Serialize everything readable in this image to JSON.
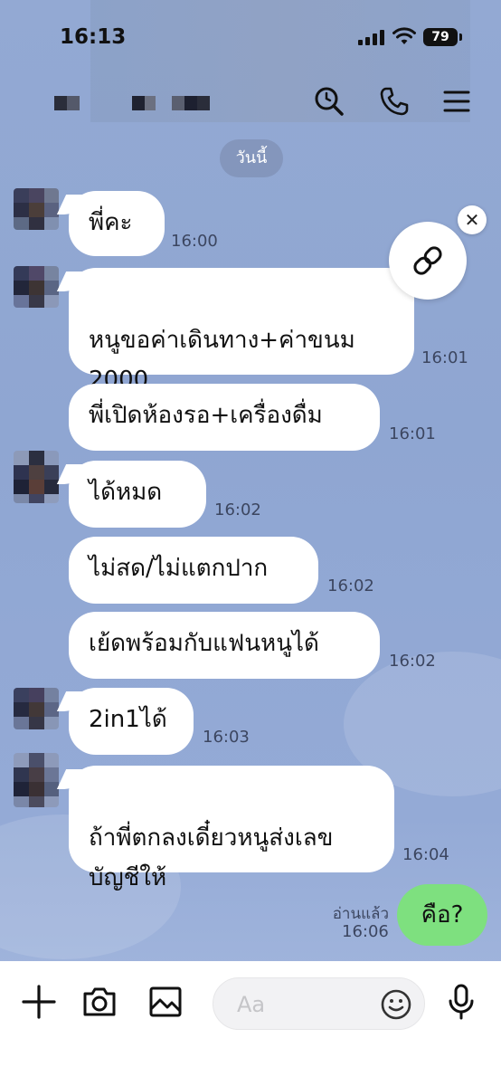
{
  "status_bar": {
    "time": "16:13",
    "battery": "79"
  },
  "header": {
    "contact_name": ""
  },
  "date_label": "วันนี้",
  "messages": [
    {
      "text": "พี่คะ",
      "time": "16:00"
    },
    {
      "text": "หนูขอค่าเดินทาง+ค่าขนม\n2000",
      "time": "16:01"
    },
    {
      "text": "พี่เปิดห้องรอ+เครื่องดื่ม",
      "time": "16:01"
    },
    {
      "text": "ได้หมด",
      "time": "16:02"
    },
    {
      "text": "ไม่สด/ไม่แตกปาก",
      "time": "16:02"
    },
    {
      "text": "เย้ดพร้อมกับแฟนหนูได้",
      "time": "16:02"
    },
    {
      "text": "2in1ได้",
      "time": "16:03"
    },
    {
      "text": "ถ้าพี่ตกลงเดี๋ยวหนูส่งเลข\nบัญชีให้",
      "time": "16:04"
    }
  ],
  "sent_message": {
    "text": "คือ?",
    "read_label": "อ่านแล้ว",
    "time": "16:06"
  },
  "input": {
    "placeholder": "Aa"
  },
  "icons": {
    "search": "search-icon",
    "call": "phone-icon",
    "menu": "menu-icon",
    "link": "link-icon",
    "close": "close-icon",
    "add": "plus-icon",
    "camera": "camera-icon",
    "gallery": "image-icon",
    "emoji": "emoji-icon",
    "mic": "microphone-icon"
  },
  "colors": {
    "background": "#93a9d3",
    "sent_bubble": "#7ee07f",
    "received_bubble": "#ffffff"
  }
}
